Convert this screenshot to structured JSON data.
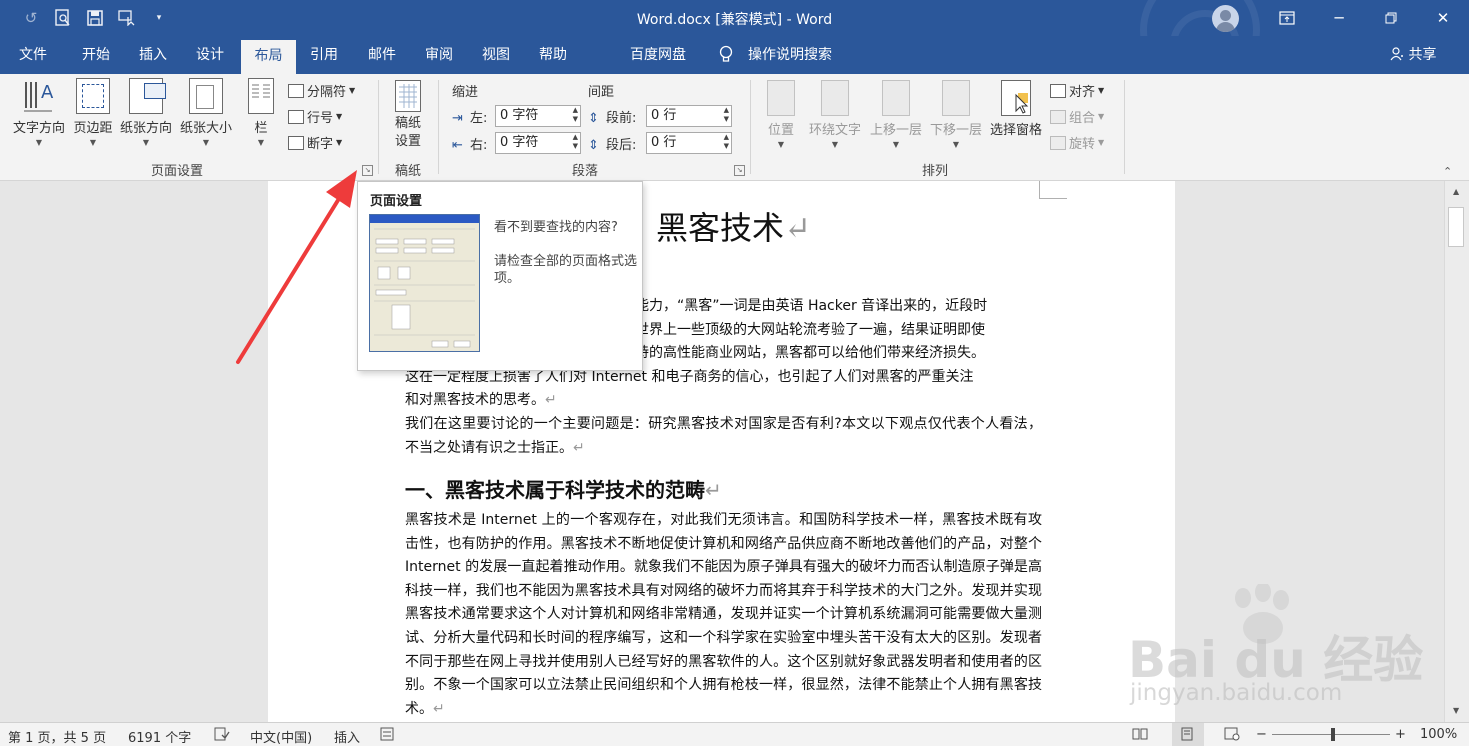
{
  "window": {
    "title": "Word.docx [兼容模式]  -  Word",
    "accent_color": "#2b579a"
  },
  "qat": {
    "undo_icon": "undo-icon",
    "print_preview_icon": "print-preview-icon",
    "save_icon": "save-icon",
    "touch_mode_icon": "touch-mode-icon",
    "customize_icon": "customize-qat-icon"
  },
  "tabs": [
    {
      "label": "文件"
    },
    {
      "label": "开始"
    },
    {
      "label": "插入"
    },
    {
      "label": "设计"
    },
    {
      "label": "布局"
    },
    {
      "label": "引用"
    },
    {
      "label": "邮件"
    },
    {
      "label": "审阅"
    },
    {
      "label": "视图"
    },
    {
      "label": "帮助"
    },
    {
      "label": "百度网盘"
    }
  ],
  "active_tab": "布局",
  "tell_me": "操作说明搜索",
  "share": "共享",
  "ribbon": {
    "page_setup": {
      "text_direction": "文字方向",
      "margins": "页边距",
      "orientation": "纸张方向",
      "size": "纸张大小",
      "columns": "栏",
      "breaks": "分隔符",
      "line_numbers": "行号",
      "hyphenation": "断字",
      "group_label": "页面设置"
    },
    "manuscript": {
      "settings": "稿纸\n设置",
      "group_label": "稿纸"
    },
    "paragraph": {
      "indent_label": "缩进",
      "spacing_label": "间距",
      "left_label": "左:",
      "left_value": "0 字符",
      "right_label": "右:",
      "right_value": "0 字符",
      "before_label": "段前:",
      "before_value": "0 行",
      "after_label": "段后:",
      "after_value": "0 行",
      "group_label": "段落"
    },
    "arrange": {
      "position": "位置",
      "wrap_text": "环绕文字",
      "bring_forward": "上移一层",
      "send_backward": "下移一层",
      "selection_pane": "选择窗格",
      "align": "对齐",
      "group": "组合",
      "rotate": "旋转",
      "group_label": "排列"
    }
  },
  "popup": {
    "title": "页面设置",
    "text1": "看不到要查找的内容?",
    "text2": "请检查全部的页面格式选项。"
  },
  "document": {
    "title": "黑客技术",
    "para1_lines": [
      "能力，“黑客”一词是由英语 Hacker 音译出来的，近段时",
      "世界上一些顶级的大网站轮流考验了一遍，结果证明即使",
      "持的高性能商业网站，黑客都可以给他们带来经济损失。",
      "这在一定程度上损害了人们对 Internet 和电子商务的信心，也引起了人们对黑客的严重关注",
      "和对黑客技术的思考。"
    ],
    "para2": "我们在这里要讨论的一个主要问题是：研究黑客技术对国家是否有利?本文以下观点仅代表个人看法，不当之处请有识之士指正。",
    "heading1": "一、黑客技术属于科学技术的范畴",
    "para3": "黑客技术是 Internet 上的一个客观存在，对此我们无须讳言。和国防科学技术一样，黑客技术既有攻击性，也有防护的作用。黑客技术不断地促使计算机和网络产品供应商不断地改善他们的产品，对整个 Internet 的发展一直起着推动作用。就象我们不能因为原子弹具有强大的破坏力而否认制造原子弹是高科技一样，我们也不能因为黑客技术具有对网络的破坏力而将其弃于科学技术的大门之外。发现并实现黑客技术通常要求这个人对计算机和网络非常精通，发现并证实一个计算机系统漏洞可能需要做大量测试、分析大量代码和长时间的程序编写，这和一个科学家在实验室中埋头苦干没有太大的区别。发现者不同于那些在网上寻找并使用别人已经写好的黑客软件的人。这个区别就好象武器发明者和使用者的区别。不象一个国家可以立法禁止民间组织和个人拥有枪枝一样，很显然，法律不能禁止个人拥有黑客技术。",
    "paragraph_mark": "↵"
  },
  "statusbar": {
    "page": "第 1 页，共 5 页",
    "words": "6191 个字",
    "language": "中文(中国)",
    "mode": "插入",
    "zoom_minus": "−",
    "zoom_plus": "+",
    "zoom": "100%"
  },
  "watermark": {
    "main": "Bai du 经验",
    "sub": "jingyan.baidu.com"
  }
}
